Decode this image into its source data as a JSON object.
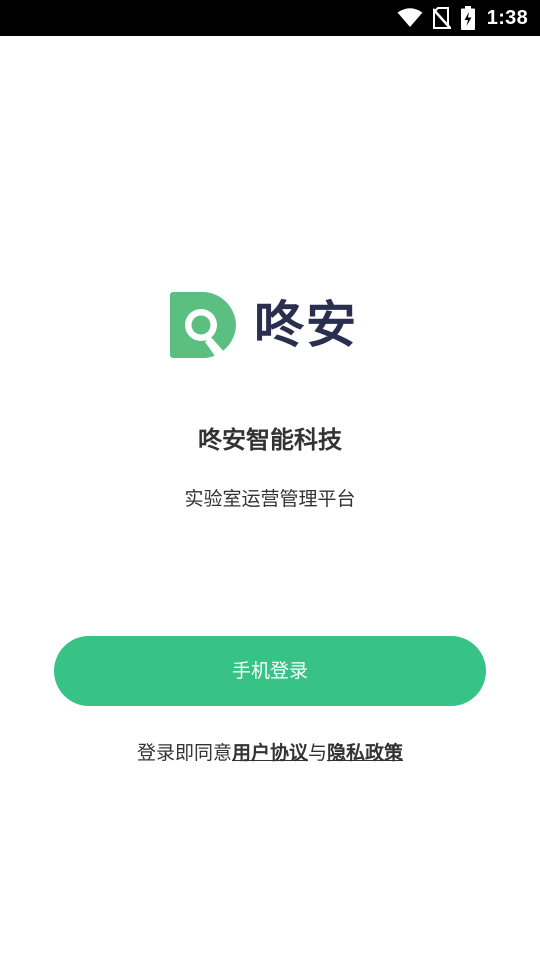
{
  "status_bar": {
    "time": "1:38",
    "icons": [
      "wifi-icon",
      "no-sim-icon",
      "battery-charging-icon"
    ]
  },
  "logo": {
    "text": "咚安",
    "icon": "magnifier-logo-icon",
    "colors": {
      "mark": "#5bbf82",
      "text": "#2b2f4f"
    }
  },
  "company_name": "咚安智能科技",
  "subtitle": "实验室运营管理平台",
  "login_button": {
    "label": "手机登录",
    "color": "#38c386"
  },
  "agreement": {
    "prefix": "登录即同意",
    "user_agreement": "用户协议",
    "conjunction": "与",
    "privacy_policy": "隐私政策"
  }
}
